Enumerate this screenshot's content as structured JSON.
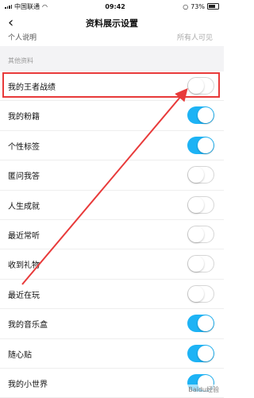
{
  "status_bar": {
    "carrier": "中国联通",
    "time": "09:42",
    "battery": "73%"
  },
  "nav": {
    "title": "资料展示设置"
  },
  "partial_row": {
    "label": "个人说明",
    "value": "所有人可见"
  },
  "section_header": "其他资料",
  "rows": [
    {
      "label": "我的王者战绩",
      "on": false
    },
    {
      "label": "我的粉籍",
      "on": true
    },
    {
      "label": "个性标签",
      "on": true
    },
    {
      "label": "匿问我答",
      "on": false
    },
    {
      "label": "人生成就",
      "on": false
    },
    {
      "label": "最近常听",
      "on": false
    },
    {
      "label": "收到礼物",
      "on": false
    },
    {
      "label": "最近在玩",
      "on": false
    },
    {
      "label": "我的音乐盒",
      "on": true
    },
    {
      "label": "随心贴",
      "on": true
    },
    {
      "label": "我的小世界",
      "on": true
    }
  ],
  "colors": {
    "accent": "#1db3f5",
    "annotation": "#e83a3a"
  },
  "watermark": "Baidu经验"
}
